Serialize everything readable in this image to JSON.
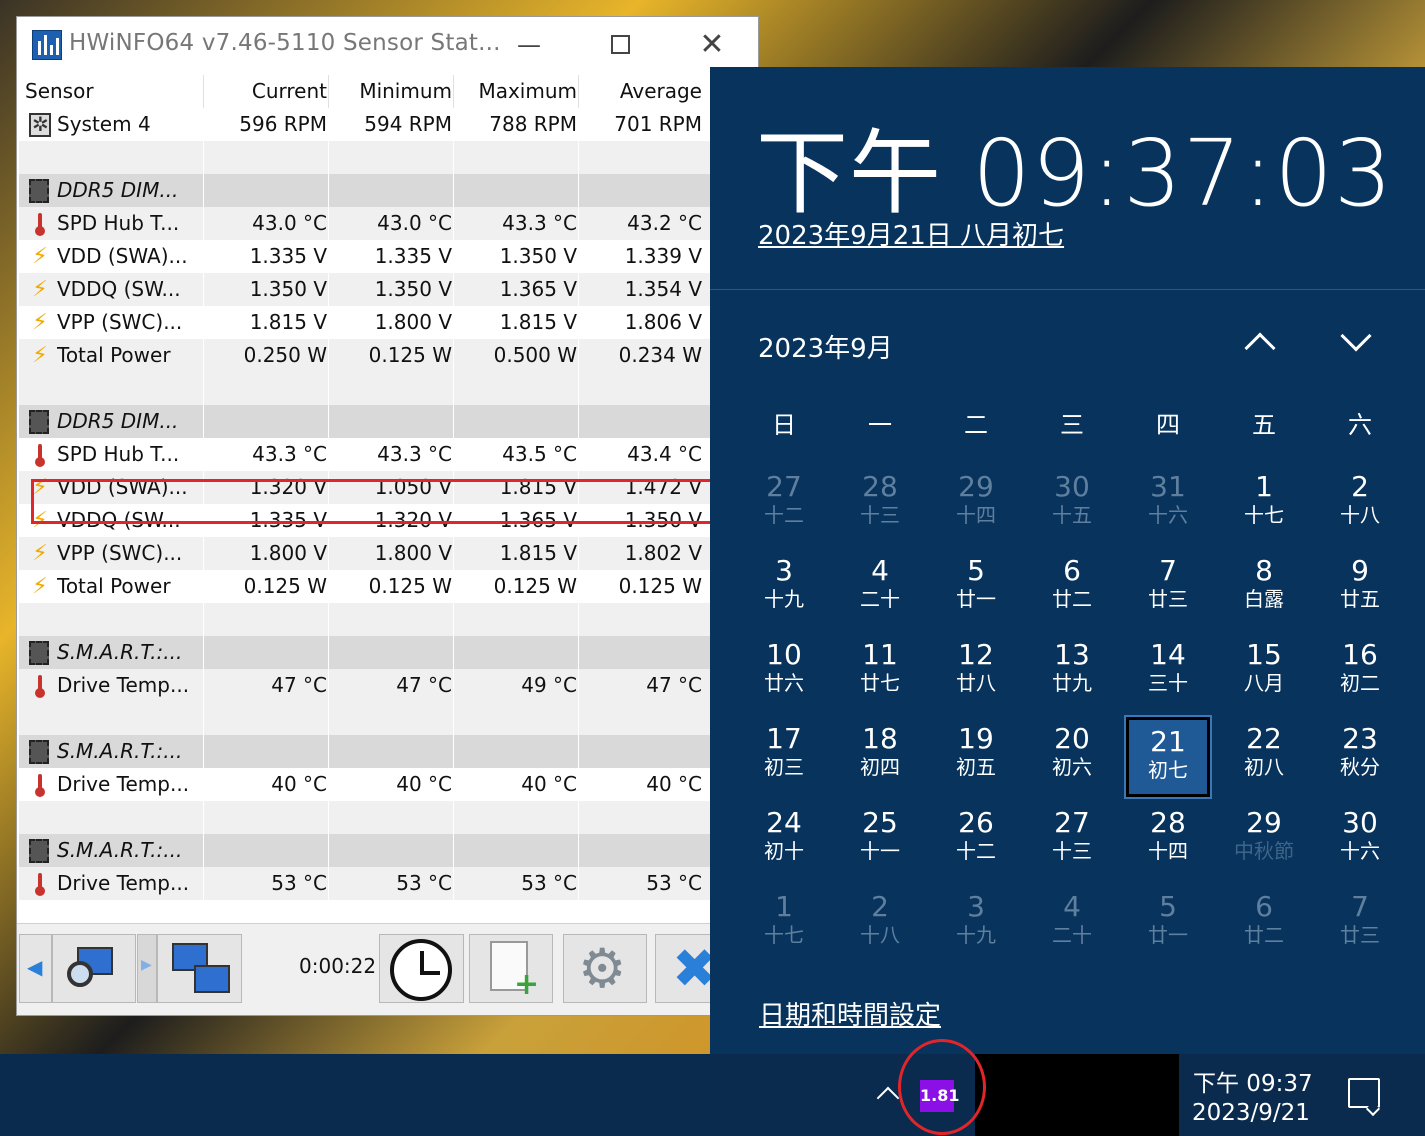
{
  "hwinfo": {
    "title": "HWiNFO64 v7.46-5110 Sensor Stat...",
    "columns": [
      "Sensor",
      "Current",
      "Minimum",
      "Maximum",
      "Average"
    ],
    "rows": [
      {
        "kind": "sensor",
        "icon": "fan-icon",
        "name": "System 4",
        "current": "596 RPM",
        "min": "594 RPM",
        "max": "788 RPM",
        "avg": "701 RPM"
      },
      {
        "kind": "empty"
      },
      {
        "kind": "group",
        "icon": "chip-icon",
        "name": "DDR5 DIM..."
      },
      {
        "kind": "sensor",
        "icon": "thermometer-icon",
        "name": "SPD Hub T...",
        "current": "43.0 °C",
        "min": "43.0 °C",
        "max": "43.3 °C",
        "avg": "43.2 °C"
      },
      {
        "kind": "sensor",
        "icon": "bolt-icon",
        "name": "VDD (SWA)...",
        "current": "1.335 V",
        "min": "1.335 V",
        "max": "1.350 V",
        "avg": "1.339 V"
      },
      {
        "kind": "sensor",
        "icon": "bolt-icon",
        "name": "VDDQ (SW...",
        "current": "1.350 V",
        "min": "1.350 V",
        "max": "1.365 V",
        "avg": "1.354 V"
      },
      {
        "kind": "sensor",
        "icon": "bolt-icon",
        "name": "VPP (SWC)...",
        "current": "1.815 V",
        "min": "1.800 V",
        "max": "1.815 V",
        "avg": "1.806 V"
      },
      {
        "kind": "sensor",
        "icon": "bolt-icon",
        "name": "Total Power",
        "current": "0.250 W",
        "min": "0.125 W",
        "max": "0.500 W",
        "avg": "0.234 W"
      },
      {
        "kind": "empty"
      },
      {
        "kind": "group",
        "icon": "chip-icon",
        "name": "DDR5 DIM..."
      },
      {
        "kind": "sensor",
        "icon": "thermometer-icon",
        "name": "SPD Hub T...",
        "current": "43.3 °C",
        "min": "43.3 °C",
        "max": "43.5 °C",
        "avg": "43.4 °C"
      },
      {
        "kind": "sensor",
        "icon": "bolt-icon",
        "name": "VDD (SWA)...",
        "current": "1.320 V",
        "min": "1.050 V",
        "max": "1.815 V",
        "avg": "1.472 V",
        "highlighted": true
      },
      {
        "kind": "sensor",
        "icon": "bolt-icon",
        "name": "VDDQ (SW...",
        "current": "1.335 V",
        "min": "1.320 V",
        "max": "1.365 V",
        "avg": "1.350 V"
      },
      {
        "kind": "sensor",
        "icon": "bolt-icon",
        "name": "VPP (SWC)...",
        "current": "1.800 V",
        "min": "1.800 V",
        "max": "1.815 V",
        "avg": "1.802 V"
      },
      {
        "kind": "sensor",
        "icon": "bolt-icon",
        "name": "Total Power",
        "current": "0.125 W",
        "min": "0.125 W",
        "max": "0.125 W",
        "avg": "0.125 W"
      },
      {
        "kind": "empty"
      },
      {
        "kind": "group",
        "icon": "chip-icon",
        "name": "S.M.A.R.T.:..."
      },
      {
        "kind": "sensor",
        "icon": "thermometer-icon",
        "name": "Drive Temp...",
        "current": "47 °C",
        "min": "47 °C",
        "max": "49 °C",
        "avg": "47 °C"
      },
      {
        "kind": "empty"
      },
      {
        "kind": "group",
        "icon": "chip-icon",
        "name": "S.M.A.R.T.:..."
      },
      {
        "kind": "sensor",
        "icon": "thermometer-icon",
        "name": "Drive Temp...",
        "current": "40 °C",
        "min": "40 °C",
        "max": "40 °C",
        "avg": "40 °C"
      },
      {
        "kind": "empty"
      },
      {
        "kind": "group",
        "icon": "chip-icon",
        "name": "S.M.A.R.T.:..."
      },
      {
        "kind": "sensor",
        "icon": "thermometer-icon",
        "name": "Drive Temp...",
        "current": "53 °C",
        "min": "53 °C",
        "max": "53 °C",
        "avg": "53 °C"
      }
    ],
    "toolbar": {
      "timer": "0:00:22",
      "icons": [
        "back-arrow-icon",
        "network-search-icon",
        "network-computers-icon",
        "clock-icon",
        "add-report-icon",
        "settings-gear-icon",
        "close-x-icon"
      ]
    },
    "highlight_color": "#e0262b"
  },
  "calendar": {
    "time": "下午 09:37:03",
    "date_link": "2023年9月21日 八月初七",
    "month_label": "2023年9月",
    "weekdays": [
      "日",
      "一",
      "二",
      "三",
      "四",
      "五",
      "六"
    ],
    "weeks": [
      [
        {
          "d": "27",
          "l": "十二",
          "dim": true
        },
        {
          "d": "28",
          "l": "十三",
          "dim": true
        },
        {
          "d": "29",
          "l": "十四",
          "dim": true
        },
        {
          "d": "30",
          "l": "十五",
          "dim": true
        },
        {
          "d": "31",
          "l": "十六",
          "dim": true
        },
        {
          "d": "1",
          "l": "十七"
        },
        {
          "d": "2",
          "l": "十八"
        }
      ],
      [
        {
          "d": "3",
          "l": "十九"
        },
        {
          "d": "4",
          "l": "二十"
        },
        {
          "d": "5",
          "l": "廿一"
        },
        {
          "d": "6",
          "l": "廿二"
        },
        {
          "d": "7",
          "l": "廿三"
        },
        {
          "d": "8",
          "l": "白露"
        },
        {
          "d": "9",
          "l": "廿五"
        }
      ],
      [
        {
          "d": "10",
          "l": "廿六"
        },
        {
          "d": "11",
          "l": "廿七"
        },
        {
          "d": "12",
          "l": "廿八"
        },
        {
          "d": "13",
          "l": "廿九"
        },
        {
          "d": "14",
          "l": "三十"
        },
        {
          "d": "15",
          "l": "八月"
        },
        {
          "d": "16",
          "l": "初二"
        }
      ],
      [
        {
          "d": "17",
          "l": "初三"
        },
        {
          "d": "18",
          "l": "初四"
        },
        {
          "d": "19",
          "l": "初五"
        },
        {
          "d": "20",
          "l": "初六"
        },
        {
          "d": "21",
          "l": "初七",
          "today": true
        },
        {
          "d": "22",
          "l": "初八"
        },
        {
          "d": "23",
          "l": "秋分"
        }
      ],
      [
        {
          "d": "24",
          "l": "初十"
        },
        {
          "d": "25",
          "l": "十一"
        },
        {
          "d": "26",
          "l": "十二"
        },
        {
          "d": "27",
          "l": "十三"
        },
        {
          "d": "28",
          "l": "十四"
        },
        {
          "d": "29",
          "l": "中秋節",
          "faint": true
        },
        {
          "d": "30",
          "l": "十六"
        }
      ],
      [
        {
          "d": "1",
          "l": "十七",
          "dim": true
        },
        {
          "d": "2",
          "l": "十八",
          "dim": true
        },
        {
          "d": "3",
          "l": "十九",
          "dim": true
        },
        {
          "d": "4",
          "l": "二十",
          "dim": true
        },
        {
          "d": "5",
          "l": "廿一",
          "dim": true
        },
        {
          "d": "6",
          "l": "廿二",
          "dim": true
        },
        {
          "d": "7",
          "l": "廿三",
          "dim": true
        }
      ]
    ],
    "settings_link": "日期和時間設定",
    "bg_color": "#07335c"
  },
  "taskbar": {
    "tray_badge": "1.81",
    "badge_color": "#8a10e6",
    "time": "下午 09:37",
    "date": "2023/9/21"
  }
}
